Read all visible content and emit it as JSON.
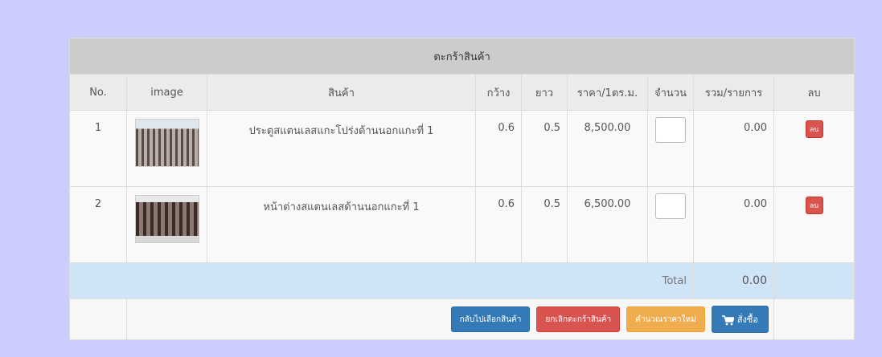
{
  "cart": {
    "title": "ตะกร้าสินค้า",
    "headers": {
      "no": "No.",
      "image": "image",
      "product": "สินค้า",
      "width": "กว้าง",
      "length": "ยาว",
      "price": "ราคา/1ตร.ม.",
      "qty": "จำนวน",
      "subtotal": "รวม/รายการ",
      "delete": "ลบ"
    },
    "items": [
      {
        "no": "1",
        "image_icon": "gate-photo",
        "name": "ประตูสแตนเลสแกะโปร่งด้านนอกแกะที่ 1",
        "width": "0.6",
        "length": "0.5",
        "price": "8,500.00",
        "qty": "",
        "subtotal": "0.00",
        "delete_label": "ลบ"
      },
      {
        "no": "2",
        "image_icon": "window-photo",
        "name": "หน้าต่างสแตนเลสด้านนอกแกะที่ 1",
        "width": "0.6",
        "length": "0.5",
        "price": "6,500.00",
        "qty": "",
        "subtotal": "0.00",
        "delete_label": "ลบ"
      }
    ],
    "total_label": "Total",
    "total_value": "0.00",
    "buttons": {
      "back": "กลับไปเลือกสินค้า",
      "cancel": "ยกเลิกตะกร้าสินค้า",
      "recalc": "คำนวณราคาใหม่",
      "buy": "สั่งซื้อ"
    }
  },
  "colors": {
    "page_bg": "#ccccff",
    "title_bg": "#cccccc",
    "header_bg": "#ebebeb",
    "total_bg": "#d0e4f8",
    "primary": "#337ab7",
    "danger": "#d9534f",
    "warning": "#f0ad4e"
  }
}
